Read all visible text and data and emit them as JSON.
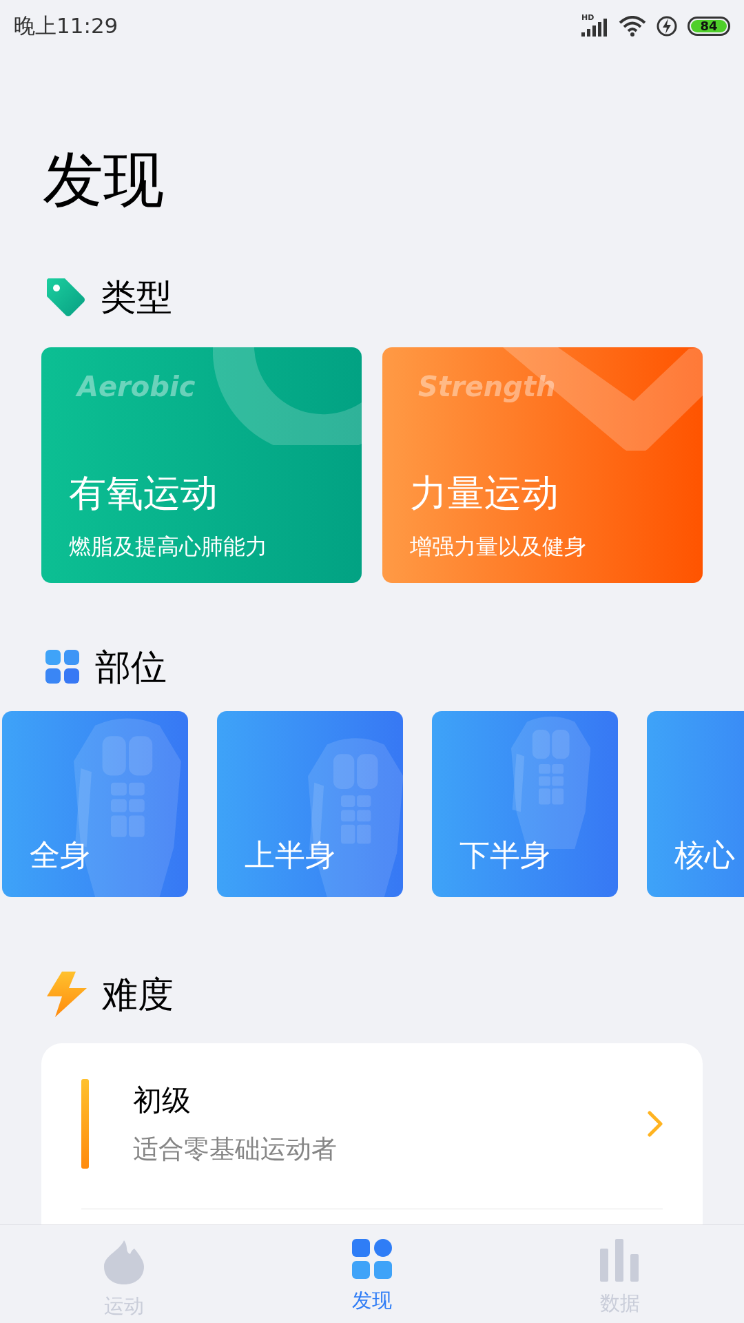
{
  "status_bar": {
    "time": "晚上11:29",
    "signal_label": "HD",
    "battery": "84"
  },
  "title": "发现",
  "type_section": {
    "title": "类型",
    "cards": [
      {
        "kind": "aerobic",
        "english": "Aerobic",
        "title": "有氧运动",
        "subtitle": "燃脂及提高心肺能力"
      },
      {
        "kind": "strength",
        "english": "Strength",
        "title": "力量运动",
        "subtitle": "增强力量以及健身"
      }
    ]
  },
  "body_section": {
    "title": "部位",
    "cards": [
      {
        "kind": "full",
        "label": "全身"
      },
      {
        "kind": "upper",
        "label": "上半身"
      },
      {
        "kind": "lower",
        "label": "下半身"
      },
      {
        "kind": "core",
        "label": "核心"
      }
    ]
  },
  "difficulty_section": {
    "title": "难度",
    "items": [
      {
        "title": "初级",
        "subtitle": "适合零基础运动者"
      }
    ]
  },
  "tab_bar": [
    {
      "kind": "workout",
      "label": "运动",
      "selected": false
    },
    {
      "kind": "discover",
      "label": "发现",
      "selected": true
    },
    {
      "kind": "data",
      "label": "数据",
      "selected": false
    }
  ]
}
